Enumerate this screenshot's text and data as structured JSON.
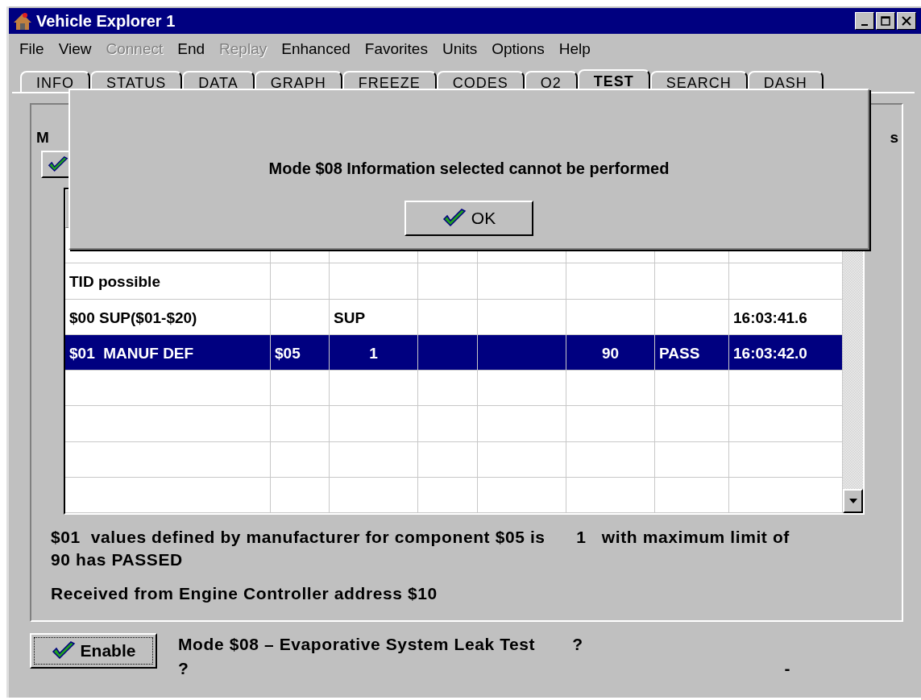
{
  "window": {
    "title": "Vehicle Explorer 1"
  },
  "menu": [
    {
      "label": "File",
      "disabled": false
    },
    {
      "label": "View",
      "disabled": false
    },
    {
      "label": "Connect",
      "disabled": true
    },
    {
      "label": "End",
      "disabled": false
    },
    {
      "label": "Replay",
      "disabled": true
    },
    {
      "label": "Enhanced",
      "disabled": false
    },
    {
      "label": "Favorites",
      "disabled": false
    },
    {
      "label": "Units",
      "disabled": false
    },
    {
      "label": "Options",
      "disabled": false
    },
    {
      "label": "Help",
      "disabled": false
    }
  ],
  "tabs": [
    {
      "label": "INFO",
      "selected": false
    },
    {
      "label": "STATUS",
      "selected": false
    },
    {
      "label": "DATA",
      "selected": false
    },
    {
      "label": "GRAPH",
      "selected": false
    },
    {
      "label": "FREEZE",
      "selected": false
    },
    {
      "label": "CODES",
      "selected": false
    },
    {
      "label": "O2",
      "selected": false
    },
    {
      "label": "TEST",
      "selected": true
    },
    {
      "label": "SEARCH",
      "selected": false
    },
    {
      "label": "DASH",
      "selected": false
    }
  ],
  "panel": {
    "label_left": "M",
    "label_right": "s"
  },
  "table": {
    "rows": [
      {
        "selected": false,
        "cells": [
          "",
          "",
          "",
          "",
          "",
          "",
          "",
          ""
        ]
      },
      {
        "selected": false,
        "cells": [
          "TID possible",
          "",
          "",
          "",
          "",
          "",
          "",
          ""
        ]
      },
      {
        "selected": false,
        "cells": [
          "$00 SUP($01-$20)",
          "",
          "SUP",
          "",
          "",
          "",
          "",
          "16:03:41.6"
        ]
      },
      {
        "selected": true,
        "cells": [
          "$01  MANUF DEF",
          "$05",
          "1",
          "",
          "",
          "90",
          "PASS",
          "16:03:42.0"
        ]
      },
      {
        "selected": false,
        "cells": [
          "",
          "",
          "",
          "",
          "",
          "",
          "",
          ""
        ]
      },
      {
        "selected": false,
        "cells": [
          "",
          "",
          "",
          "",
          "",
          "",
          "",
          ""
        ]
      },
      {
        "selected": false,
        "cells": [
          "",
          "",
          "",
          "",
          "",
          "",
          "",
          ""
        ]
      },
      {
        "selected": false,
        "cells": [
          "",
          "",
          "",
          "",
          "",
          "",
          "",
          ""
        ]
      }
    ]
  },
  "result_text": "$01  values defined by manufacturer for component $05 is      1   with maximum limit of  90 has PASSED",
  "source_text": "Received from Engine Controller address $10",
  "enable_button": "Enable",
  "mode_text": "Mode $08 – Evaporative System Leak Test",
  "mode_status": "?",
  "status_2": "?",
  "status_3": "-",
  "dialog": {
    "message": "Mode $08 Information selected cannot be performed",
    "button": "OK"
  }
}
